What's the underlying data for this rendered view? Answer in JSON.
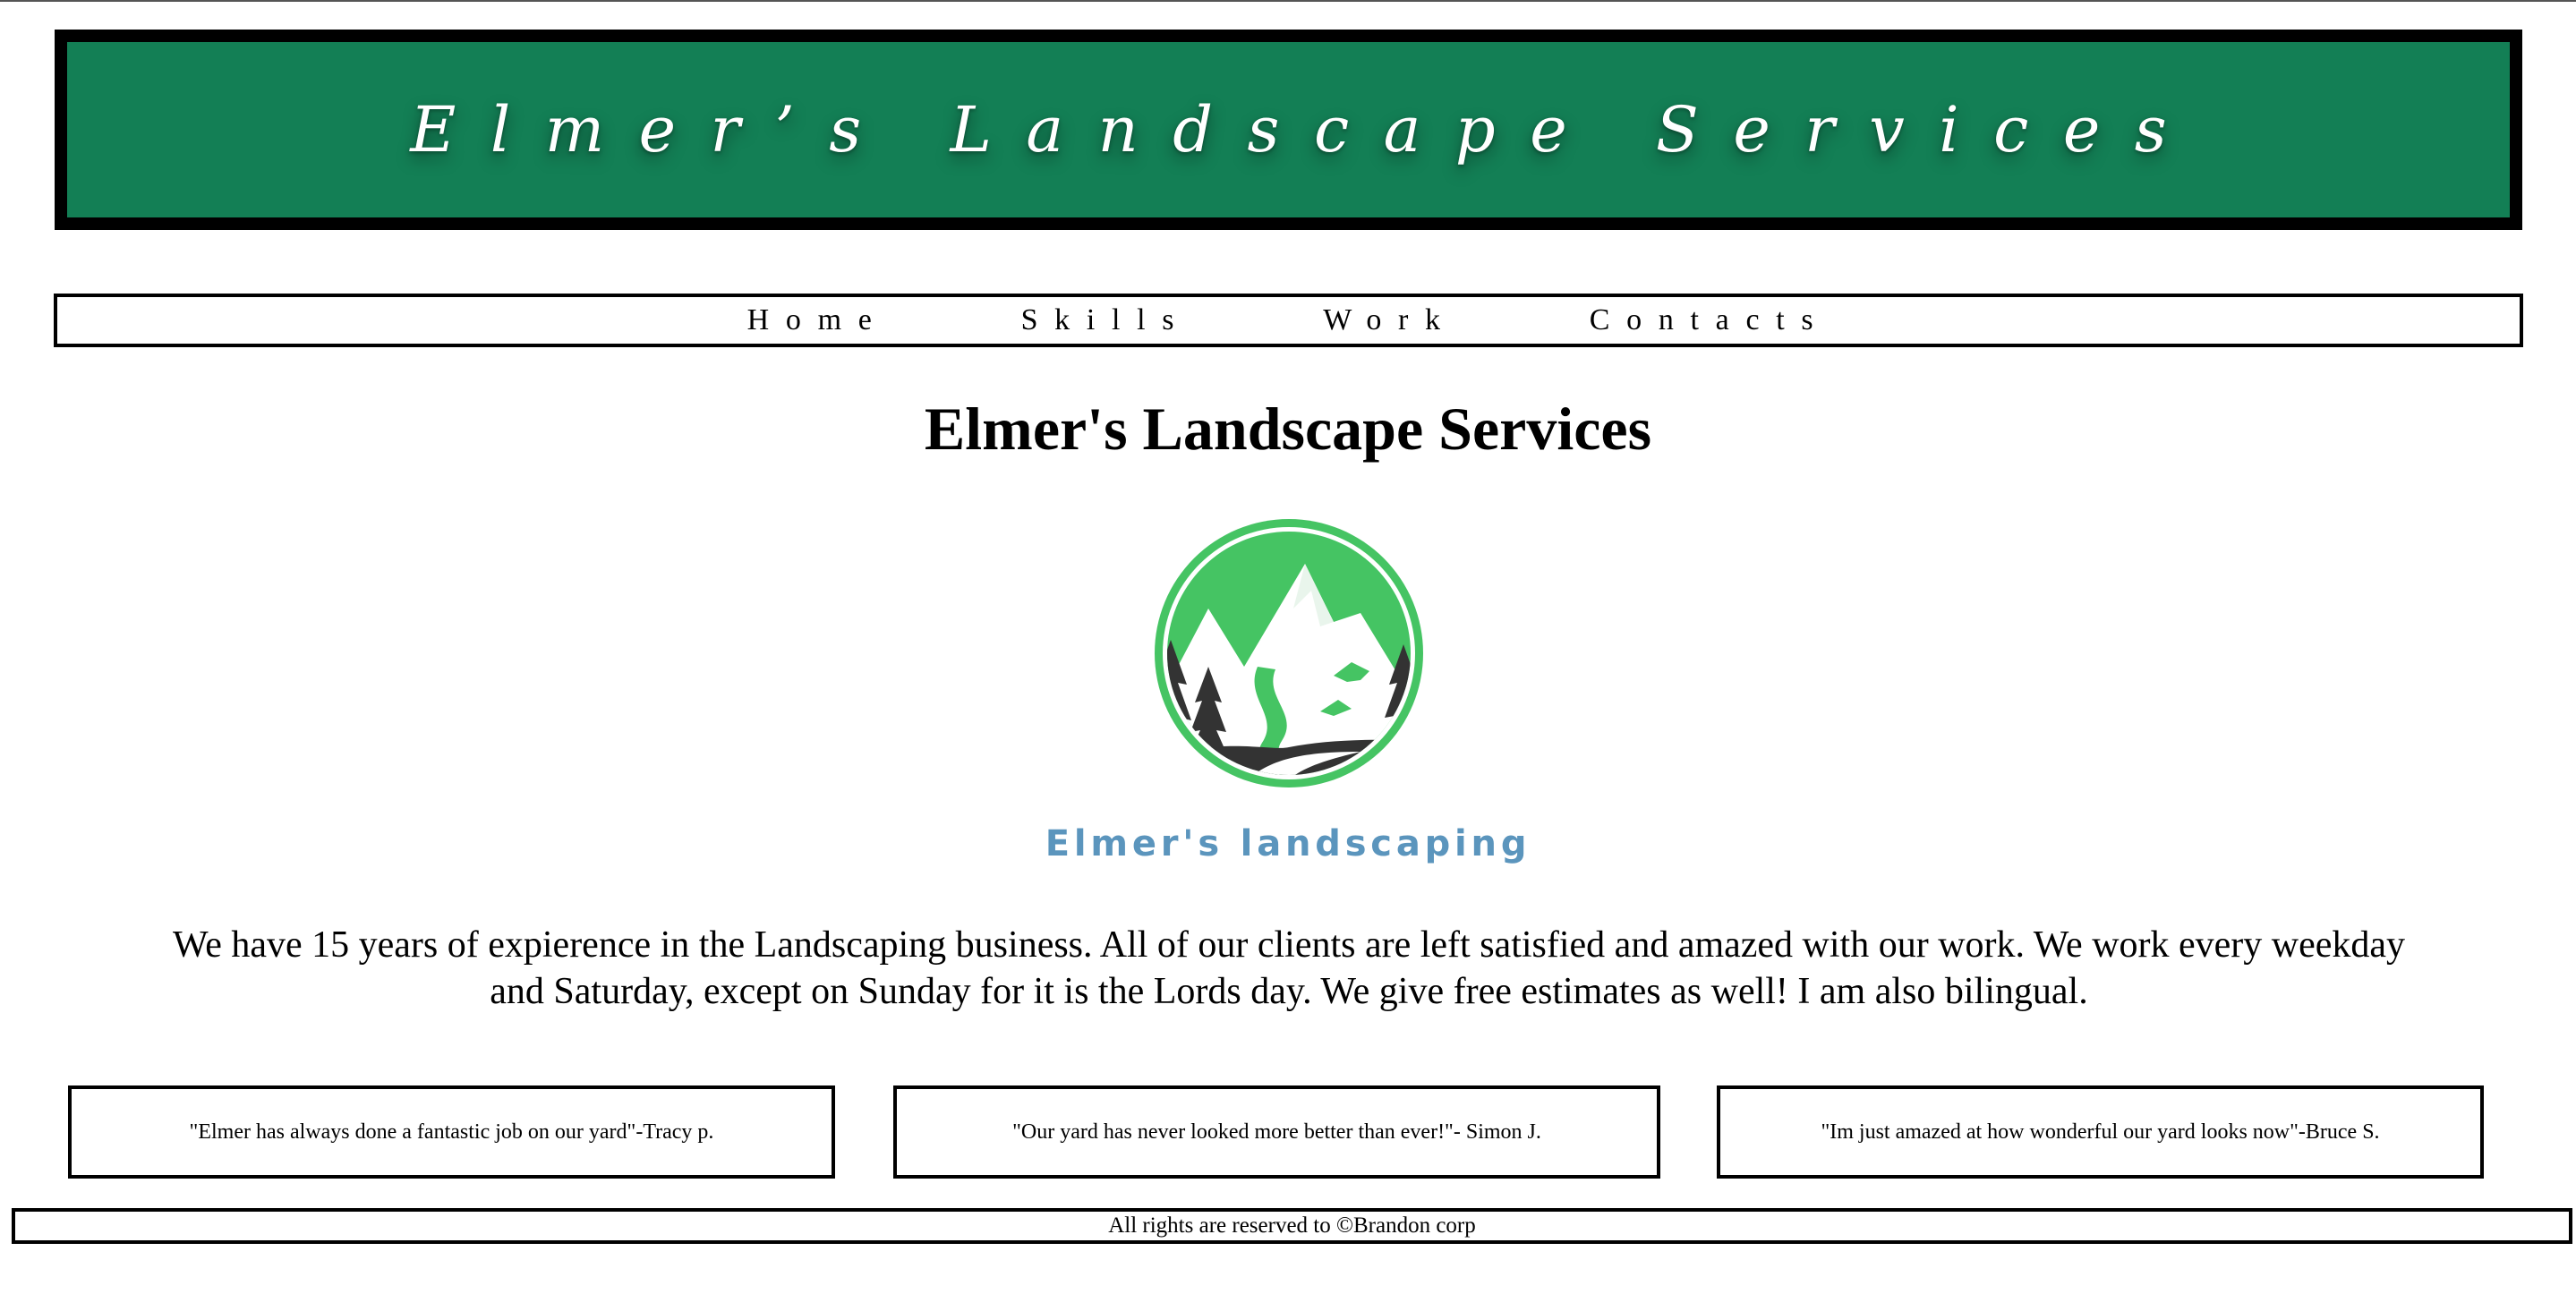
{
  "banner": {
    "title": "Elmer’s Landscape Services"
  },
  "nav": {
    "items": [
      {
        "label": "Home"
      },
      {
        "label": "Skills"
      },
      {
        "label": "Work"
      },
      {
        "label": "Contacts"
      }
    ]
  },
  "main": {
    "title": "Elmer's Landscape Services",
    "logo_caption": "Elmer's landscaping",
    "intro": "We have 15 years of expierence in the Landscaping business. All of our clients are left satisfied and amazed with our work. We work every weekday and Saturday, except on Sunday for it is the Lords day. We give free estimates as well! I am also bilingual."
  },
  "testimonials": [
    {
      "text": "\"Elmer has always done a fantastic job on our yard\"-Tracy p."
    },
    {
      "text": "\"Our yard has never looked more better than ever!\"- Simon J."
    },
    {
      "text": "\"Im just amazed at how wonderful our yard looks now\"-Bruce S."
    }
  ],
  "footer": {
    "text": "All rights are reserved to ©Brandon corp"
  },
  "colors": {
    "banner_bg": "#137f55",
    "logo_green": "#45c463",
    "logo_dark": "#333333",
    "caption_blue": "#5b95bd"
  }
}
